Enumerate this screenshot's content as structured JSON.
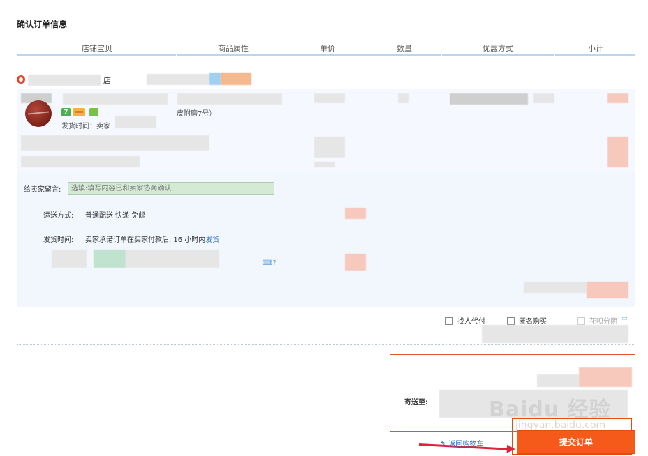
{
  "page_title": "确认订单信息",
  "columns": [
    "店铺宝贝",
    "商品属性",
    "单价",
    "数量",
    "优惠方式",
    "小计"
  ],
  "shop": {
    "name_suffix": "店",
    "icon": "shop-icon"
  },
  "item": {
    "attribute_text": "皮附磨7号）",
    "ship_time_label": "发货时间：卖家",
    "badges": [
      "7",
      "card-icon",
      "leaf-icon"
    ]
  },
  "message": {
    "label": "给卖家留言:",
    "placeholder": "选填:填写内容已和卖家协商确认"
  },
  "shipping": {
    "label": "运送方式:",
    "value": "普通配送 快递 免邮"
  },
  "delivery_time": {
    "label": "发货时间:",
    "value": "卖家承诺订单在买家付款后, 16 小时内",
    "link": "发货"
  },
  "options": {
    "pay_by_friend": "找人代付",
    "anonymous": "匿名购买",
    "installment": "花呗分期"
  },
  "summary": {
    "ship_to_label": "寄送至:"
  },
  "actions": {
    "back_to_cart": "返回购物车",
    "submit": "提交订单"
  },
  "watermark": {
    "main": "Baidu 经验",
    "sub": "jingyan.baidu.com"
  },
  "colors": {
    "accent": "#f55a1b",
    "header_line": "#b9d6f0",
    "link": "#2b72c6"
  }
}
